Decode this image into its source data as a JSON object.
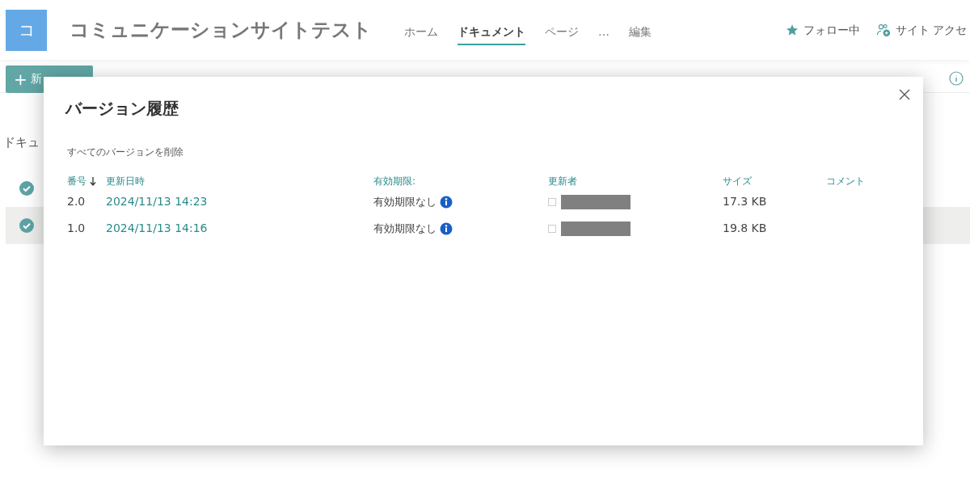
{
  "site": {
    "logo_letter": "コ",
    "title": "コミュニケーションサイトテスト"
  },
  "nav": [
    {
      "label": "ホーム",
      "selected": false
    },
    {
      "label": "ドキュメント",
      "selected": true
    },
    {
      "label": "ページ",
      "selected": false
    },
    {
      "label": "…",
      "selected": false
    },
    {
      "label": "編集",
      "selected": false
    }
  ],
  "header_actions": [
    {
      "kind": "follow",
      "label": "フォロー中"
    },
    {
      "kind": "access",
      "label": "サイト アクセ"
    }
  ],
  "new_button": {
    "icon": "+",
    "label": "新"
  },
  "page_heading": "ドキュ",
  "dialog": {
    "title": "バージョン履歴",
    "delete_all": "すべてのバージョンを削除",
    "columns": [
      "番号",
      "更新日時",
      "有効期限:",
      "更新者",
      "サイズ",
      "コメント"
    ],
    "rows": [
      {
        "number": "2.0",
        "modified": "2024/11/13 14:23",
        "expiry": "有効期限なし",
        "checked": false,
        "size": "17.3 KB"
      },
      {
        "number": "1.0",
        "modified": "2024/11/13 14:16",
        "expiry": "有効期限なし",
        "checked": false,
        "size": "19.8 KB"
      }
    ]
  }
}
